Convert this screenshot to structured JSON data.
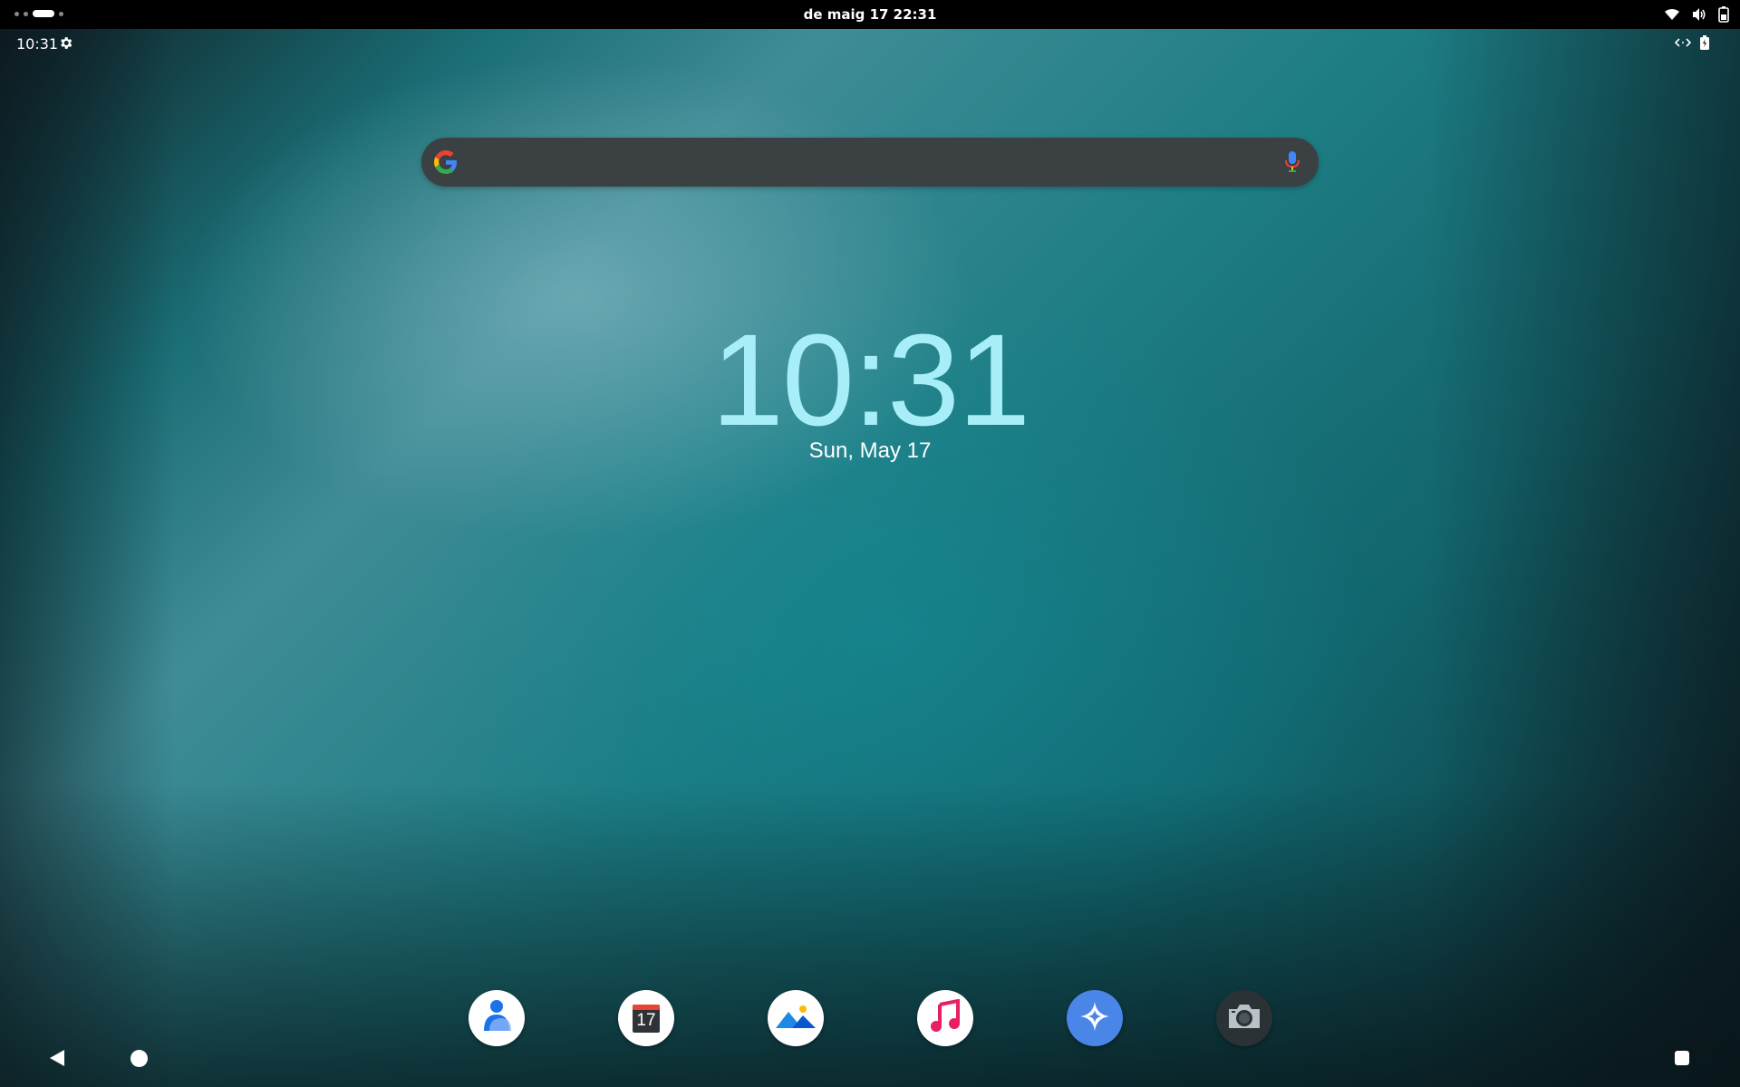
{
  "host_bar": {
    "datetime": "de maig 17  22:31",
    "workspace_count": 4,
    "active_workspace": 3
  },
  "status_bar": {
    "time": "10:31",
    "icons": [
      "settings-icon",
      "data-saver-icon",
      "battery-charging-icon"
    ]
  },
  "search": {
    "placeholder": "",
    "icons": [
      "google-logo",
      "mic-icon"
    ]
  },
  "clock_widget": {
    "time": "10:31",
    "date": "Sun, May 17"
  },
  "dock": {
    "apps": [
      {
        "name": "contacts",
        "icon": "contacts-icon",
        "bg": "#ffffff",
        "color": "#1a73e8"
      },
      {
        "name": "calendar",
        "icon": "calendar-icon",
        "bg": "#ffffff",
        "day": "17"
      },
      {
        "name": "gallery",
        "icon": "gallery-icon",
        "bg": "#ffffff",
        "color": "#1e88e5"
      },
      {
        "name": "music",
        "icon": "music-icon",
        "bg": "#ffffff",
        "color": "#e91e63"
      },
      {
        "name": "assistant",
        "icon": "sparkle-icon",
        "bg": "#4a86e8"
      },
      {
        "name": "camera",
        "icon": "camera-icon",
        "bg": "#2b3236"
      }
    ]
  },
  "nav_bar": {
    "icons": [
      "back-icon",
      "home-icon",
      "recents-icon"
    ]
  },
  "colors": {
    "clock": "#a8eef8",
    "search_bg": "#3b4043",
    "topbar": "#000000"
  }
}
